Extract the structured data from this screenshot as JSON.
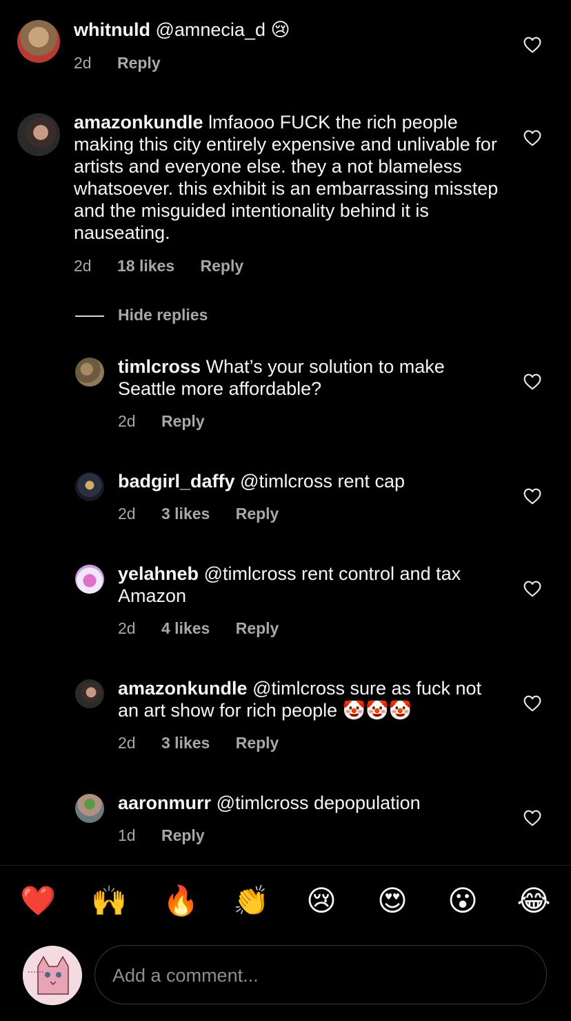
{
  "comments": [
    {
      "user": "whitnuld",
      "body": "@amnecia_d 😢",
      "time": "2d",
      "likes": "",
      "reply": "Reply"
    },
    {
      "user": "amazonkundle",
      "body": "lmfaooo FUCK the rich people making this city entirely expensive and unlivable for artists and everyone else. they a not blameless whatsoever. this exhibit is an embarrassing misstep and the misguided intentionality behind it is nauseating.",
      "time": "2d",
      "likes": "18 likes",
      "reply": "Reply"
    }
  ],
  "hide_replies": "Hide replies",
  "replies": [
    {
      "user": "timlcross",
      "body": "What’s your solution to make Seattle more affordable?",
      "time": "2d",
      "likes": "",
      "reply": "Reply"
    },
    {
      "user": "badgirl_daffy",
      "body": "@timlcross rent cap",
      "time": "2d",
      "likes": "3 likes",
      "reply": "Reply"
    },
    {
      "user": "yelahneb",
      "body": "@timlcross rent control and tax Amazon",
      "time": "2d",
      "likes": "4 likes",
      "reply": "Reply"
    },
    {
      "user": "amazonkundle",
      "body": "@timlcross sure as fuck not an art show for rich people 🤡🤡🤡",
      "time": "2d",
      "likes": "3 likes",
      "reply": "Reply"
    },
    {
      "user": "aaronmurr",
      "body": "@timlcross depopulation",
      "time": "1d",
      "likes": "",
      "reply": "Reply"
    }
  ],
  "emojis": [
    "❤️",
    "🙌",
    "🔥",
    "👏",
    "😢",
    "😍",
    "😮",
    "😂"
  ],
  "composer": {
    "placeholder": "Add a comment..."
  },
  "icons": {
    "like": "heart-outline-icon"
  },
  "colors": {
    "background": "#000000",
    "text": "#f5f5f5",
    "meta": "#a8a8a8"
  }
}
